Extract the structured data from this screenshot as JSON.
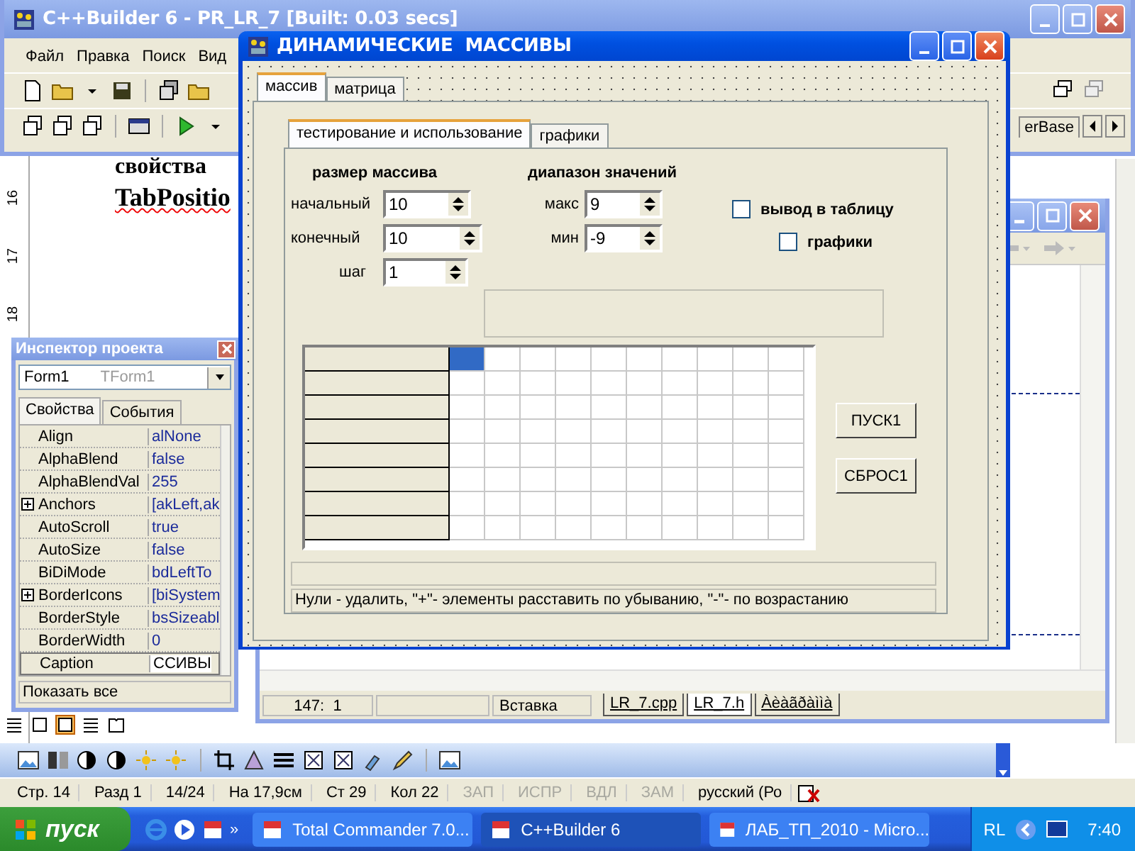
{
  "document": {
    "lines": [
      "свойства",
      "TabPositio"
    ],
    "ruler_marks": [
      "16",
      "17",
      "18"
    ]
  },
  "builder_window": {
    "title": "C++Builder 6 - PR_LR_7 [Built: 0.03 secs]",
    "menu": [
      "Файл",
      "Правка",
      "Поиск",
      "Вид"
    ],
    "palette_tab": "erBase"
  },
  "editor": {
    "position": "147:  1",
    "mode": "Вставка",
    "tabs": [
      {
        "label": "LR_7.cpp",
        "selected": false
      },
      {
        "label": "LR_7.h",
        "selected": true
      },
      {
        "label": "Àèàãðàììà",
        "selected": false
      }
    ]
  },
  "inspector": {
    "title": "Инспектор проекта",
    "object": "Form1",
    "object_type": "TForm1",
    "tabs": [
      {
        "label": "Свойства",
        "selected": true
      },
      {
        "label": "События",
        "selected": false
      }
    ],
    "properties": [
      {
        "name": "Align",
        "value": "alNone",
        "expandable": false,
        "selected": false
      },
      {
        "name": "AlphaBlend",
        "value": "false",
        "expandable": false,
        "selected": false
      },
      {
        "name": "AlphaBlendVal",
        "value": "255",
        "expandable": false,
        "selected": false
      },
      {
        "name": "Anchors",
        "value": "[akLeft,ak",
        "expandable": true,
        "selected": false
      },
      {
        "name": "AutoScroll",
        "value": "true",
        "expandable": false,
        "selected": false
      },
      {
        "name": "AutoSize",
        "value": "false",
        "expandable": false,
        "selected": false
      },
      {
        "name": "BiDiMode",
        "value": "bdLeftTo",
        "expandable": false,
        "selected": false
      },
      {
        "name": "BorderIcons",
        "value": "[biSystem",
        "expandable": true,
        "selected": false
      },
      {
        "name": "BorderStyle",
        "value": "bsSizeabl",
        "expandable": false,
        "selected": false
      },
      {
        "name": "BorderWidth",
        "value": "0",
        "expandable": false,
        "selected": false
      },
      {
        "name": "Caption",
        "value": "ССИВЫ",
        "expandable": false,
        "selected": true
      }
    ],
    "footer": "Показать все"
  },
  "dialog": {
    "title": "ДИНАМИЧЕСКИЕ  МАССИВЫ",
    "tabs": [
      {
        "label": "массив",
        "selected": true
      },
      {
        "label": "матрица",
        "selected": false
      }
    ],
    "subtabs": [
      {
        "label": "тестирование и использование",
        "selected": true
      },
      {
        "label": "графики",
        "selected": false
      }
    ],
    "size_heading": "размер массива",
    "range_heading": "диапазон значений",
    "size_fields": [
      {
        "label": "начальный",
        "value": "10"
      },
      {
        "label": "конечный",
        "value": "10"
      },
      {
        "label": "шаг",
        "value": "1"
      }
    ],
    "range_fields": [
      {
        "label": "макс",
        "value": "9"
      },
      {
        "label": "мин",
        "value": "-9"
      }
    ],
    "checkboxes": [
      {
        "label": "вывод в таблицу",
        "checked": false
      },
      {
        "label": "графики",
        "checked": false
      }
    ],
    "grid": {
      "rows": [
        {
          "cells": [
            {
              "selected": true
            },
            {
              "selected": false
            },
            {
              "selected": false
            },
            {
              "selected": false
            },
            {
              "selected": false
            },
            {
              "selected": false
            },
            {
              "selected": false
            },
            {
              "selected": false
            },
            {
              "selected": false
            },
            {
              "selected": false
            }
          ]
        },
        {
          "cells": [
            {
              "selected": false
            },
            {
              "selected": false
            },
            {
              "selected": false
            },
            {
              "selected": false
            },
            {
              "selected": false
            },
            {
              "selected": false
            },
            {
              "selected": false
            },
            {
              "selected": false
            },
            {
              "selected": false
            },
            {
              "selected": false
            }
          ]
        },
        {
          "cells": [
            {
              "selected": false
            },
            {
              "selected": false
            },
            {
              "selected": false
            },
            {
              "selected": false
            },
            {
              "selected": false
            },
            {
              "selected": false
            },
            {
              "selected": false
            },
            {
              "selected": false
            },
            {
              "selected": false
            },
            {
              "selected": false
            }
          ]
        },
        {
          "cells": [
            {
              "selected": false
            },
            {
              "selected": false
            },
            {
              "selected": false
            },
            {
              "selected": false
            },
            {
              "selected": false
            },
            {
              "selected": false
            },
            {
              "selected": false
            },
            {
              "selected": false
            },
            {
              "selected": false
            },
            {
              "selected": false
            }
          ]
        },
        {
          "cells": [
            {
              "selected": false
            },
            {
              "selected": false
            },
            {
              "selected": false
            },
            {
              "selected": false
            },
            {
              "selected": false
            },
            {
              "selected": false
            },
            {
              "selected": false
            },
            {
              "selected": false
            },
            {
              "selected": false
            },
            {
              "selected": false
            }
          ]
        },
        {
          "cells": [
            {
              "selected": false
            },
            {
              "selected": false
            },
            {
              "selected": false
            },
            {
              "selected": false
            },
            {
              "selected": false
            },
            {
              "selected": false
            },
            {
              "selected": false
            },
            {
              "selected": false
            },
            {
              "selected": false
            },
            {
              "selected": false
            }
          ]
        },
        {
          "cells": [
            {
              "selected": false
            },
            {
              "selected": false
            },
            {
              "selected": false
            },
            {
              "selected": false
            },
            {
              "selected": false
            },
            {
              "selected": false
            },
            {
              "selected": false
            },
            {
              "selected": false
            },
            {
              "selected": false
            },
            {
              "selected": false
            }
          ]
        },
        {
          "cells": [
            {
              "selected": false
            },
            {
              "selected": false
            },
            {
              "selected": false
            },
            {
              "selected": false
            },
            {
              "selected": false
            },
            {
              "selected": false
            },
            {
              "selected": false
            },
            {
              "selected": false
            },
            {
              "selected": false
            },
            {
              "selected": false
            }
          ]
        }
      ]
    },
    "buttons": [
      "ПУСК1",
      "СБРОС1"
    ],
    "hint": "Нули - удалить, \"+\"- элементы расставить по убыванию, \"-\"- по возрастанию"
  },
  "word_status": [
    {
      "text": "Стр. 14",
      "disabled": false
    },
    {
      "text": "Разд 1",
      "disabled": false
    },
    {
      "text": "14/24",
      "disabled": false
    },
    {
      "text": "На 17,9см",
      "disabled": false
    },
    {
      "text": "Ст 29",
      "disabled": false
    },
    {
      "text": "Кол 22",
      "disabled": false
    },
    {
      "text": "ЗАП",
      "disabled": true
    },
    {
      "text": "ИСПР",
      "disabled": true
    },
    {
      "text": "ВДЛ",
      "disabled": true
    },
    {
      "text": "ЗАМ",
      "disabled": true
    },
    {
      "text": "русский (Ро",
      "disabled": false
    }
  ],
  "taskbar": {
    "start": "пуск",
    "more": "»",
    "tasks": [
      {
        "label": "Total Commander 7.0...",
        "selected": false
      },
      {
        "label": "C++Builder 6",
        "selected": true
      },
      {
        "label": "ЛАБ_ТП_2010 - Micro...",
        "selected": false
      }
    ],
    "language": "RL",
    "clock": "7:40"
  }
}
